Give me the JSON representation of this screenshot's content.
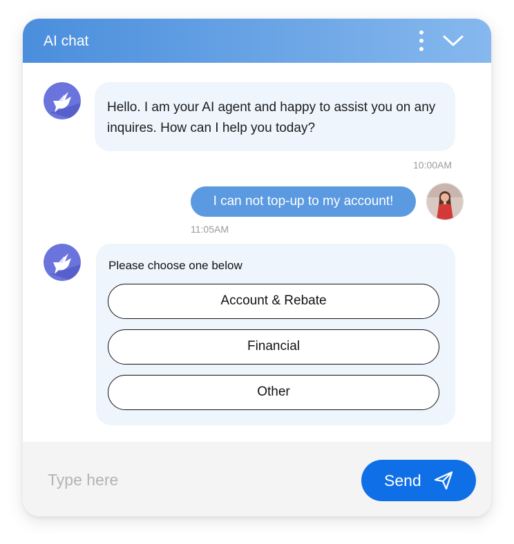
{
  "header": {
    "title": "AI chat",
    "more_icon": "more-vertical-icon",
    "collapse_icon": "chevron-down-icon"
  },
  "messages": [
    {
      "sender": "bot",
      "avatar_icon": "dove-icon",
      "text": "Hello. I am your AI agent and happy  to assist you on any inquires. How can I help you today?",
      "time": "10:00AM"
    },
    {
      "sender": "user",
      "avatar_icon": "user-photo",
      "text": "I can not top-up to my account!",
      "time": "11:05AM"
    },
    {
      "sender": "bot",
      "avatar_icon": "dove-icon",
      "prompt": "Please choose one below",
      "options": [
        "Account & Rebate",
        "Financial",
        "Other"
      ]
    }
  ],
  "composer": {
    "placeholder": "Type here",
    "value": "",
    "send_label": "Send",
    "send_icon": "paper-plane-icon"
  },
  "colors": {
    "header_start": "#4a8edc",
    "header_end": "#86b8ee",
    "bot_bubble": "#eef5fd",
    "user_bubble": "#5b9ae0",
    "send_button": "#0f6fe6",
    "bot_avatar": "#6b74dd"
  }
}
